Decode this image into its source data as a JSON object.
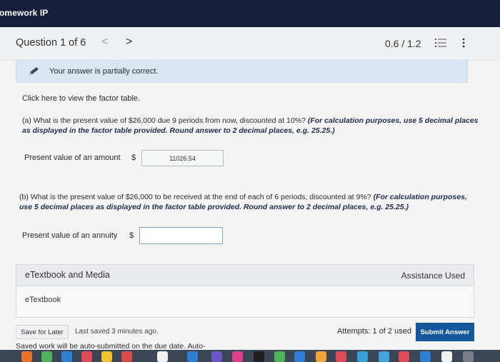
{
  "app": {
    "title": "omework IP"
  },
  "question_nav": {
    "label": "Question 1 of 6",
    "prev_glyph": "<",
    "next_glyph": ">",
    "score": "0.6 / 1.2",
    "list_icon": "list-icon",
    "more_icon": "more-vertical-icon"
  },
  "banner": {
    "icon": "pencil-icon",
    "message": "Your answer is partially correct."
  },
  "factor_link": "Click here to view the factor table.",
  "part_a": {
    "question": "(a) What is the present value of $26,000 due 9 periods from now, discounted at 10%?",
    "note": "(For calculation purposes, use 5 decimal places as displayed in the factor table provided. Round answer to 2 decimal places, e.g. 25.25.)",
    "label": "Present value of an amount",
    "currency": "$",
    "value": "11026.54"
  },
  "part_b": {
    "question": "(b) What is the present value of $26,000 to be received at the end of each of 6 periods, discounted at 9%?",
    "note": "(For calculation purposes, use 5 decimal places as displayed in the factor table provided. Round answer to 2 decimal places, e.g. 25.25.)",
    "label": "Present value of an annuity",
    "currency": "$",
    "value": ""
  },
  "etextbook": {
    "header": "eTextbook and Media",
    "assistance": "Assistance Used",
    "link": "eTextbook"
  },
  "footer": {
    "save_label": "Save for Later",
    "last_saved": "Last saved 3 minutes ago.",
    "attempts": "Attempts: 1 of 2 used",
    "submit_label": "Submit Answer",
    "auto_text": "Saved work will be auto-submitted on the due date. Auto-"
  },
  "colors": {
    "topbar": "#15203a",
    "banner": "#d9e7f3",
    "submit": "#14579d"
  }
}
